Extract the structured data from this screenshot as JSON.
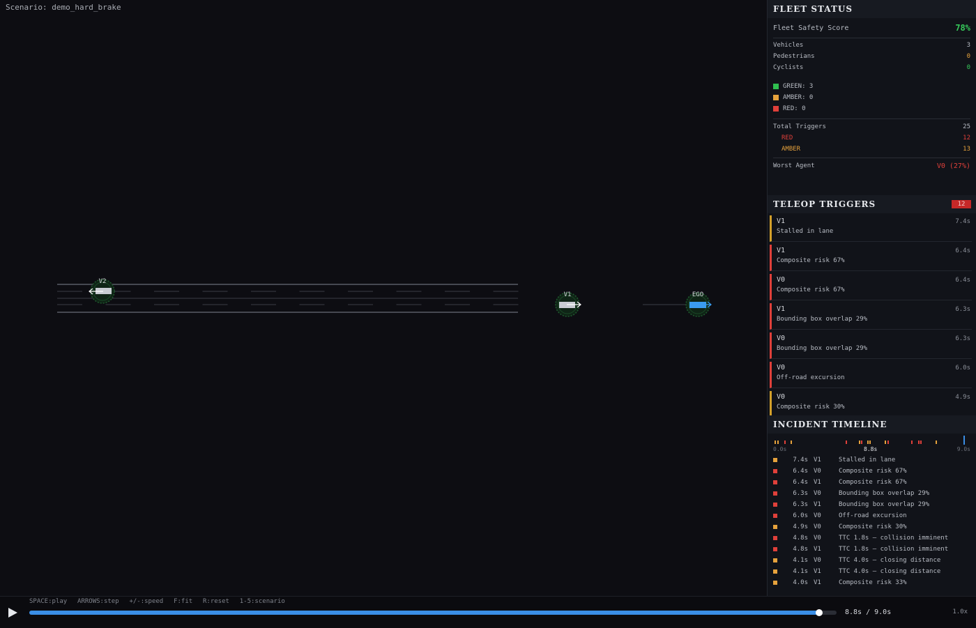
{
  "scenario": {
    "label": "Scenario: demo_hard_brake"
  },
  "agents": {
    "v2": "V2",
    "v1": "V1",
    "ego": "EGO"
  },
  "fleet": {
    "title": "FLEET STATUS",
    "score_label": "Fleet Safety Score",
    "score_value": "78%",
    "counts": [
      {
        "label": "Vehicles",
        "value": "3"
      },
      {
        "label": "Pedestrians",
        "value": "0"
      },
      {
        "label": "Cyclists",
        "value": "0"
      }
    ],
    "legend": {
      "green": "GREEN: 3",
      "amber": "AMBER: 0",
      "red": "RED: 0"
    },
    "triggers_label": "Total Triggers",
    "triggers_value": "25",
    "red_label": "RED",
    "red_value": "12",
    "amber_label": "AMBER",
    "amber_value": "13",
    "worst_label": "Worst Agent",
    "worst_value": "V0 (27%)"
  },
  "teleop": {
    "title": "TELEOP TRIGGERS",
    "badge": "12",
    "items": [
      {
        "agent": "V1",
        "time": "7.4s",
        "msg": "Stalled in lane",
        "level": "amber"
      },
      {
        "agent": "V1",
        "time": "6.4s",
        "msg": "Composite risk 67%",
        "level": "red"
      },
      {
        "agent": "V0",
        "time": "6.4s",
        "msg": "Composite risk 67%",
        "level": "red"
      },
      {
        "agent": "V1",
        "time": "6.3s",
        "msg": "Bounding box overlap 29%",
        "level": "red"
      },
      {
        "agent": "V0",
        "time": "6.3s",
        "msg": "Bounding box overlap 29%",
        "level": "red"
      },
      {
        "agent": "V0",
        "time": "6.0s",
        "msg": "Off-road excursion",
        "level": "red"
      },
      {
        "agent": "V0",
        "time": "4.9s",
        "msg": "Composite risk 30%",
        "level": "amber"
      }
    ]
  },
  "timeline": {
    "title": "INCIDENT TIMELINE",
    "start": "0.0s",
    "now": "8.8s",
    "end": "9.0s",
    "events": [
      {
        "time": "7.4s",
        "agent": "V1",
        "msg": "Stalled in lane",
        "level": "amber"
      },
      {
        "time": "6.4s",
        "agent": "V0",
        "msg": "Composite risk 67%",
        "level": "red"
      },
      {
        "time": "6.4s",
        "agent": "V1",
        "msg": "Composite risk 67%",
        "level": "red"
      },
      {
        "time": "6.3s",
        "agent": "V0",
        "msg": "Bounding box overlap 29%",
        "level": "red"
      },
      {
        "time": "6.3s",
        "agent": "V1",
        "msg": "Bounding box overlap 29%",
        "level": "red"
      },
      {
        "time": "6.0s",
        "agent": "V0",
        "msg": "Off-road excursion",
        "level": "red"
      },
      {
        "time": "4.9s",
        "agent": "V0",
        "msg": "Composite risk 30%",
        "level": "amber"
      },
      {
        "time": "4.8s",
        "agent": "V0",
        "msg": "TTC 1.8s — collision imminent",
        "level": "red"
      },
      {
        "time": "4.8s",
        "agent": "V1",
        "msg": "TTC 1.8s — collision imminent",
        "level": "red"
      },
      {
        "time": "4.1s",
        "agent": "V0",
        "msg": "TTC 4.0s — closing distance",
        "level": "amber"
      },
      {
        "time": "4.1s",
        "agent": "V1",
        "msg": "TTC 4.0s — closing distance",
        "level": "amber"
      },
      {
        "time": "4.0s",
        "agent": "V1",
        "msg": "Composite risk 33%",
        "level": "amber"
      }
    ],
    "ticks": [
      {
        "t": 0.05,
        "level": "amber"
      },
      {
        "t": 0.2,
        "level": "amber"
      },
      {
        "t": 0.5,
        "level": "red"
      },
      {
        "t": 0.8,
        "level": "amber"
      },
      {
        "t": 3.3,
        "level": "red"
      },
      {
        "t": 3.9,
        "level": "amber"
      },
      {
        "t": 4.0,
        "level": "red"
      },
      {
        "t": 4.3,
        "level": "amber"
      },
      {
        "t": 4.4,
        "level": "amber"
      },
      {
        "t": 5.1,
        "level": "amber"
      },
      {
        "t": 5.2,
        "level": "red"
      },
      {
        "t": 6.3,
        "level": "red"
      },
      {
        "t": 6.6,
        "level": "red"
      },
      {
        "t": 6.7,
        "level": "red"
      },
      {
        "t": 7.4,
        "level": "amber"
      }
    ]
  },
  "playback": {
    "shortcuts": "SPACE:play  ARROWS:step  +/-:speed  F:fit  R:reset  1-5:scenario",
    "progress": 0.978,
    "current": "8.8s",
    "total": "9.0s",
    "time_readout": "8.8s / 9.0s",
    "speed": "1.0x"
  },
  "colors": {
    "red": "#e0403a",
    "amber": "#e6a23c",
    "green": "#36c95a",
    "accent": "#3a8ee6",
    "ego": "#3a9cf0"
  }
}
